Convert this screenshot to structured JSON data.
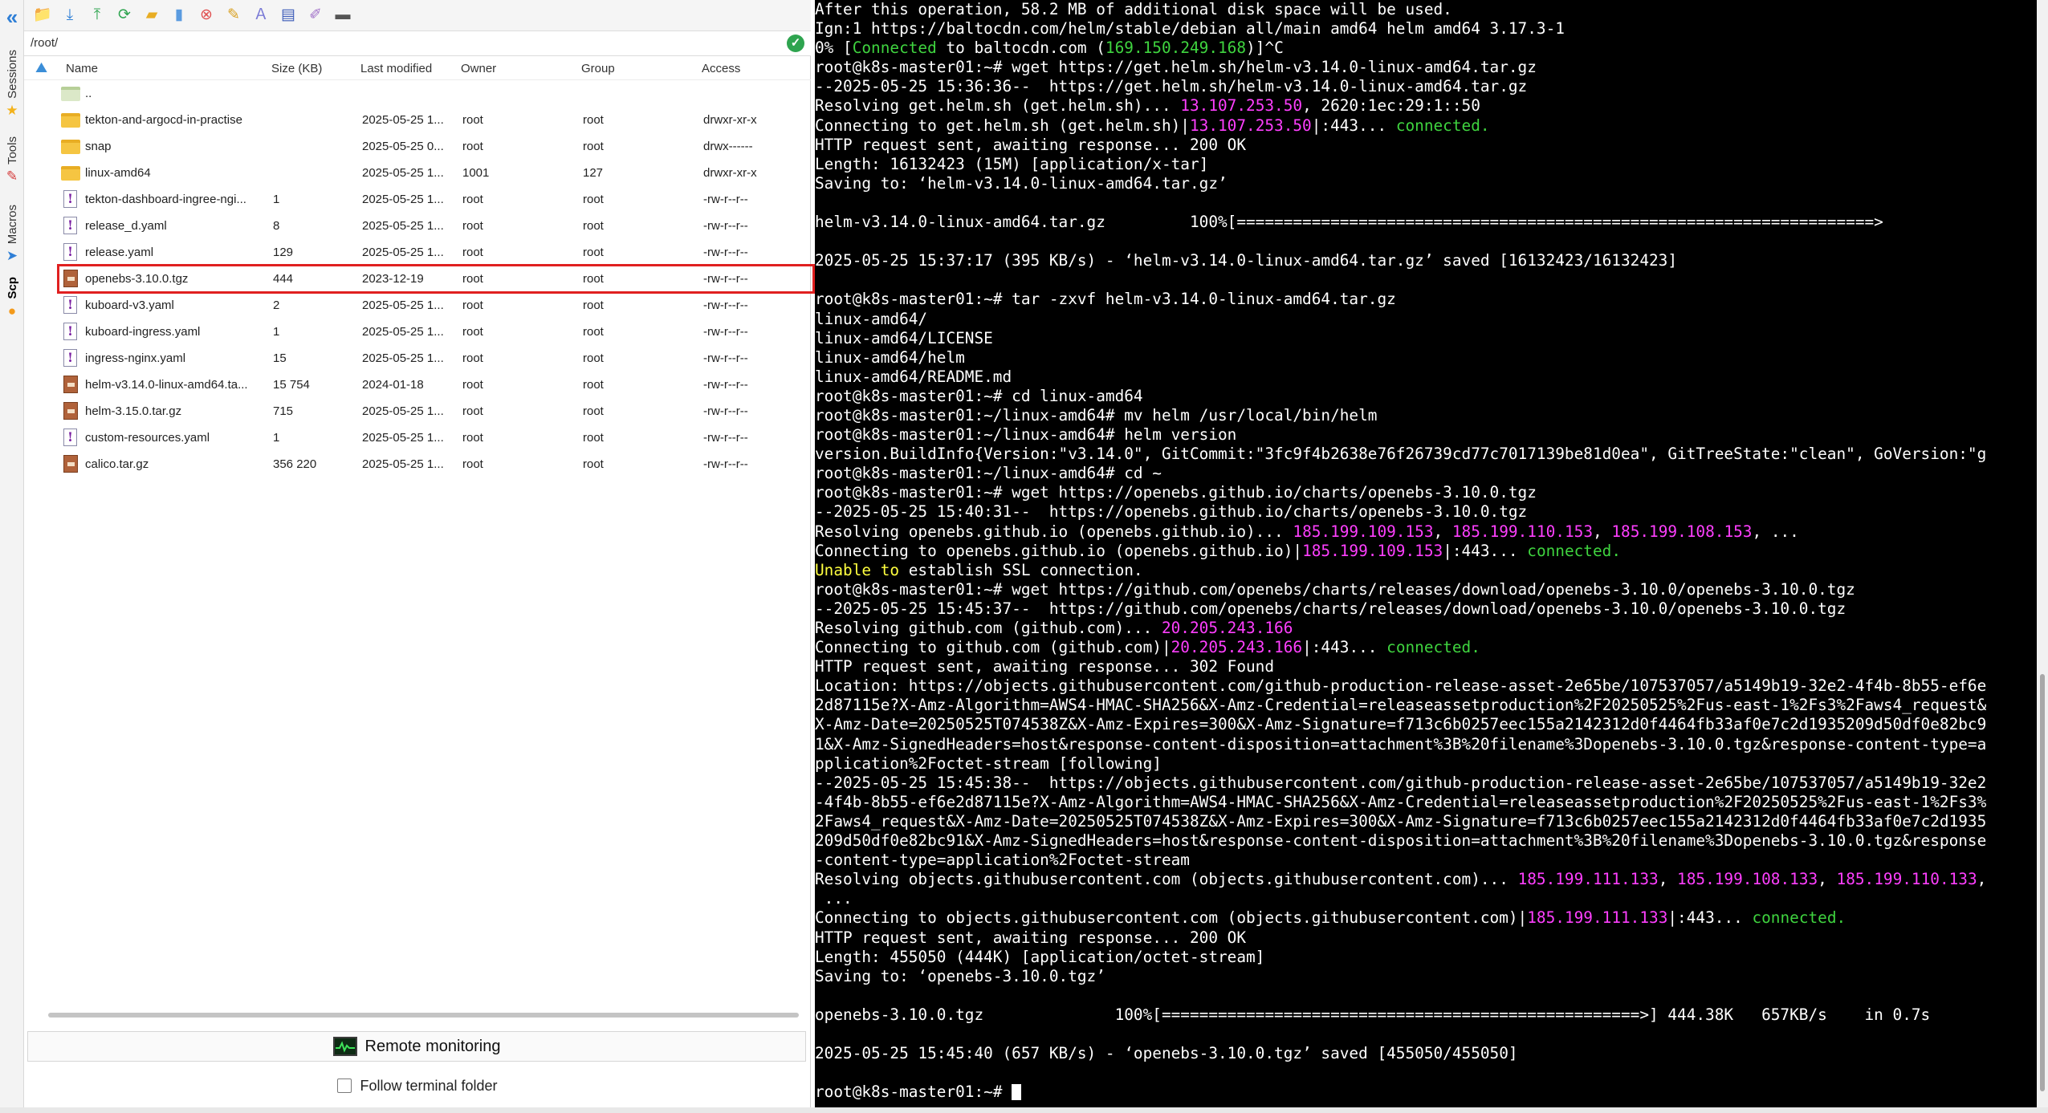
{
  "sidebar": {
    "tabs": [
      {
        "label": "Sessions",
        "icon": "star-icon"
      },
      {
        "label": "Tools",
        "icon": "tools-icon"
      },
      {
        "label": "Macros",
        "icon": "macros-icon"
      },
      {
        "label": "Scp",
        "icon": "scp-icon"
      }
    ]
  },
  "toolbar": {
    "buttons": [
      "upload-folder-icon",
      "download-icon",
      "upload-icon",
      "refresh-icon",
      "new-folder-icon",
      "new-file-icon",
      "delete-icon",
      "wrench-icon",
      "rename-icon",
      "properties-icon",
      "edit-icon",
      "terminal-icon"
    ]
  },
  "path": {
    "value": "/root/"
  },
  "file_table": {
    "columns": [
      "Name",
      "Size (KB)",
      "Last modified",
      "Owner",
      "Group",
      "Access"
    ],
    "rows": [
      {
        "type": "up",
        "name": "..",
        "size": "",
        "modified": "",
        "owner": "",
        "group": "",
        "access": ""
      },
      {
        "type": "folder",
        "name": "tekton-and-argocd-in-practise",
        "size": "",
        "modified": "2025-05-25 1...",
        "owner": "root",
        "group": "root",
        "access": "drwxr-xr-x"
      },
      {
        "type": "folder",
        "name": "snap",
        "size": "",
        "modified": "2025-05-25 0...",
        "owner": "root",
        "group": "root",
        "access": "drwx------"
      },
      {
        "type": "folder",
        "name": "linux-amd64",
        "size": "",
        "modified": "2025-05-25 1...",
        "owner": "1001",
        "group": "127",
        "access": "drwxr-xr-x"
      },
      {
        "type": "yaml",
        "name": "tekton-dashboard-ingree-ngi...",
        "size": "1",
        "modified": "2025-05-25 1...",
        "owner": "root",
        "group": "root",
        "access": "-rw-r--r--"
      },
      {
        "type": "yaml",
        "name": "release_d.yaml",
        "size": "8",
        "modified": "2025-05-25 1...",
        "owner": "root",
        "group": "root",
        "access": "-rw-r--r--"
      },
      {
        "type": "yaml",
        "name": "release.yaml",
        "size": "129",
        "modified": "2025-05-25 1...",
        "owner": "root",
        "group": "root",
        "access": "-rw-r--r--"
      },
      {
        "type": "tgz",
        "name": "openebs-3.10.0.tgz",
        "size": "444",
        "modified": "2023-12-19",
        "owner": "root",
        "group": "root",
        "access": "-rw-r--r--"
      },
      {
        "type": "yaml",
        "name": "kuboard-v3.yaml",
        "size": "2",
        "modified": "2025-05-25 1...",
        "owner": "root",
        "group": "root",
        "access": "-rw-r--r--"
      },
      {
        "type": "yaml",
        "name": "kuboard-ingress.yaml",
        "size": "1",
        "modified": "2025-05-25 1...",
        "owner": "root",
        "group": "root",
        "access": "-rw-r--r--"
      },
      {
        "type": "yaml",
        "name": "ingress-nginx.yaml",
        "size": "15",
        "modified": "2025-05-25 1...",
        "owner": "root",
        "group": "root",
        "access": "-rw-r--r--"
      },
      {
        "type": "tgz",
        "name": "helm-v3.14.0-linux-amd64.ta...",
        "size": "15 754",
        "modified": "2024-01-18",
        "owner": "root",
        "group": "root",
        "access": "-rw-r--r--"
      },
      {
        "type": "tgz",
        "name": "helm-3.15.0.tar.gz",
        "size": "715",
        "modified": "2025-05-25 1...",
        "owner": "root",
        "group": "root",
        "access": "-rw-r--r--"
      },
      {
        "type": "yaml",
        "name": "custom-resources.yaml",
        "size": "1",
        "modified": "2025-05-25 1...",
        "owner": "root",
        "group": "root",
        "access": "-rw-r--r--"
      },
      {
        "type": "tgz",
        "name": "calico.tar.gz",
        "size": "356 220",
        "modified": "2025-05-25 1...",
        "owner": "root",
        "group": "root",
        "access": "-rw-r--r--"
      }
    ]
  },
  "highlighted_row": 7,
  "remote_monitoring": {
    "label": "Remote monitoring"
  },
  "follow_terminal": {
    "label": "Follow terminal folder",
    "checked": false
  },
  "colors": {
    "green": "#3fd43f",
    "magenta": "#ff3fff",
    "yellow": "#ffff3f",
    "highlight": "#e02020"
  },
  "terminal": {
    "lines": [
      [
        {
          "t": "After this operation, 58.2 MB of additional disk space will be used."
        }
      ],
      [
        {
          "t": "Ign:1 https://baltocdn.com/helm/stable/debian all/main amd64 helm amd64 3.17.3-1"
        }
      ],
      [
        {
          "t": "0% ["
        },
        {
          "t": "Connected",
          "c": "g"
        },
        {
          "t": " to baltocdn.com ("
        },
        {
          "t": "169.150.249.168",
          "c": "g"
        },
        {
          "t": ")]^C"
        }
      ],
      [
        {
          "t": "root@k8s-master01:~# wget https://get.helm.sh/helm-v3.14.0-linux-amd64.tar.gz"
        }
      ],
      [
        {
          "t": "--2025-05-25 15:36:36--  https://get.helm.sh/helm-v3.14.0-linux-amd64.tar.gz"
        }
      ],
      [
        {
          "t": "Resolving get.helm.sh (get.helm.sh)... "
        },
        {
          "t": "13.107.253.50",
          "c": "m"
        },
        {
          "t": ", 2620:1ec:29:1::50"
        }
      ],
      [
        {
          "t": "Connecting to get.helm.sh (get.helm.sh)|"
        },
        {
          "t": "13.107.253.50",
          "c": "m"
        },
        {
          "t": "|:443... "
        },
        {
          "t": "connected.",
          "c": "g"
        }
      ],
      [
        {
          "t": "HTTP request sent, awaiting response... 200 OK"
        }
      ],
      [
        {
          "t": "Length: 16132423 (15M) [application/x-tar]"
        }
      ],
      [
        {
          "t": "Saving to: ‘helm-v3.14.0-linux-amd64.tar.gz’"
        }
      ],
      [
        {
          "t": ""
        }
      ],
      [
        {
          "t": "helm-v3.14.0-linux-amd64.tar.gz         100%[====================================================================>"
        }
      ],
      [
        {
          "t": ""
        }
      ],
      [
        {
          "t": "2025-05-25 15:37:17 (395 KB/s) - ‘helm-v3.14.0-linux-amd64.tar.gz’ saved [16132423/16132423]"
        }
      ],
      [
        {
          "t": ""
        }
      ],
      [
        {
          "t": "root@k8s-master01:~# tar -zxvf helm-v3.14.0-linux-amd64.tar.gz"
        }
      ],
      [
        {
          "t": "linux-amd64/"
        }
      ],
      [
        {
          "t": "linux-amd64/LICENSE"
        }
      ],
      [
        {
          "t": "linux-amd64/helm"
        }
      ],
      [
        {
          "t": "linux-amd64/README.md"
        }
      ],
      [
        {
          "t": "root@k8s-master01:~# cd linux-amd64"
        }
      ],
      [
        {
          "t": "root@k8s-master01:~/linux-amd64# mv helm /usr/local/bin/helm"
        }
      ],
      [
        {
          "t": "root@k8s-master01:~/linux-amd64# helm version"
        }
      ],
      [
        {
          "t": "version.BuildInfo{Version:\"v3.14.0\", GitCommit:\"3fc9f4b2638e76f26739cd77c7017139be81d0ea\", GitTreeState:\"clean\", GoVersion:\"g"
        }
      ],
      [
        {
          "t": "root@k8s-master01:~/linux-amd64# cd ~"
        }
      ],
      [
        {
          "t": "root@k8s-master01:~# wget https://openebs.github.io/charts/openebs-3.10.0.tgz"
        }
      ],
      [
        {
          "t": "--2025-05-25 15:40:31--  https://openebs.github.io/charts/openebs-3.10.0.tgz"
        }
      ],
      [
        {
          "t": "Resolving openebs.github.io (openebs.github.io)... "
        },
        {
          "t": "185.199.109.153",
          "c": "m"
        },
        {
          "t": ", "
        },
        {
          "t": "185.199.110.153",
          "c": "m"
        },
        {
          "t": ", "
        },
        {
          "t": "185.199.108.153",
          "c": "m"
        },
        {
          "t": ", ..."
        }
      ],
      [
        {
          "t": "Connecting to openebs.github.io (openebs.github.io)|"
        },
        {
          "t": "185.199.109.153",
          "c": "m"
        },
        {
          "t": "|:443... "
        },
        {
          "t": "connected.",
          "c": "g"
        }
      ],
      [
        {
          "t": "Unable to",
          "c": "y"
        },
        {
          "t": " establish SSL connection."
        }
      ],
      [
        {
          "t": "root@k8s-master01:~# wget https://github.com/openebs/charts/releases/download/openebs-3.10.0/openebs-3.10.0.tgz"
        }
      ],
      [
        {
          "t": "--2025-05-25 15:45:37--  https://github.com/openebs/charts/releases/download/openebs-3.10.0/openebs-3.10.0.tgz"
        }
      ],
      [
        {
          "t": "Resolving github.com (github.com)... "
        },
        {
          "t": "20.205.243.166",
          "c": "m"
        }
      ],
      [
        {
          "t": "Connecting to github.com (github.com)|"
        },
        {
          "t": "20.205.243.166",
          "c": "m"
        },
        {
          "t": "|:443... "
        },
        {
          "t": "connected.",
          "c": "g"
        }
      ],
      [
        {
          "t": "HTTP request sent, awaiting response... 302 Found"
        }
      ],
      [
        {
          "t": "Location: https://objects.githubusercontent.com/github-production-release-asset-2e65be/107537057/a5149b19-32e2-4f4b-8b55-ef6e"
        }
      ],
      [
        {
          "t": "2d87115e?X-Amz-Algorithm=AWS4-HMAC-SHA256&X-Amz-Credential=releaseassetproduction%2F20250525%2Fus-east-1%2Fs3%2Faws4_request&"
        }
      ],
      [
        {
          "t": "X-Amz-Date=20250525T074538Z&X-Amz-Expires=300&X-Amz-Signature=f713c6b0257eec155a2142312d0f4464fb33af0e7c2d1935209d50df0e82bc9"
        }
      ],
      [
        {
          "t": "1&X-Amz-SignedHeaders=host&response-content-disposition=attachment%3B%20filename%3Dopenebs-3.10.0.tgz&response-content-type=a"
        }
      ],
      [
        {
          "t": "pplication%2Foctet-stream [following]"
        }
      ],
      [
        {
          "t": "--2025-05-25 15:45:38--  https://objects.githubusercontent.com/github-production-release-asset-2e65be/107537057/a5149b19-32e2"
        }
      ],
      [
        {
          "t": "-4f4b-8b55-ef6e2d87115e?X-Amz-Algorithm=AWS4-HMAC-SHA256&X-Amz-Credential=releaseassetproduction%2F20250525%2Fus-east-1%2Fs3%"
        }
      ],
      [
        {
          "t": "2Faws4_request&X-Amz-Date=20250525T074538Z&X-Amz-Expires=300&X-Amz-Signature=f713c6b0257eec155a2142312d0f4464fb33af0e7c2d1935"
        }
      ],
      [
        {
          "t": "209d50df0e82bc91&X-Amz-SignedHeaders=host&response-content-disposition=attachment%3B%20filename%3Dopenebs-3.10.0.tgz&response"
        }
      ],
      [
        {
          "t": "-content-type=application%2Foctet-stream"
        }
      ],
      [
        {
          "t": "Resolving objects.githubusercontent.com (objects.githubusercontent.com)... "
        },
        {
          "t": "185.199.111.133",
          "c": "m"
        },
        {
          "t": ", "
        },
        {
          "t": "185.199.108.133",
          "c": "m"
        },
        {
          "t": ", "
        },
        {
          "t": "185.199.110.133",
          "c": "m"
        },
        {
          "t": ","
        }
      ],
      [
        {
          "t": " ..."
        }
      ],
      [
        {
          "t": "Connecting to objects.githubusercontent.com (objects.githubusercontent.com)|"
        },
        {
          "t": "185.199.111.133",
          "c": "m"
        },
        {
          "t": "|:443... "
        },
        {
          "t": "connected.",
          "c": "g"
        }
      ],
      [
        {
          "t": "HTTP request sent, awaiting response... 200 OK"
        }
      ],
      [
        {
          "t": "Length: 455050 (444K) [application/octet-stream]"
        }
      ],
      [
        {
          "t": "Saving to: ‘openebs-3.10.0.tgz’"
        }
      ],
      [
        {
          "t": ""
        }
      ],
      [
        {
          "t": "openebs-3.10.0.tgz              100%[===================================================>] 444.38K   657KB/s    in 0.7s"
        }
      ],
      [
        {
          "t": ""
        }
      ],
      [
        {
          "t": "2025-05-25 15:45:40 (657 KB/s) - ‘openebs-3.10.0.tgz’ saved [455050/455050]"
        }
      ],
      [
        {
          "t": ""
        }
      ],
      [
        {
          "t": "root@k8s-master01:~# "
        }
      ]
    ]
  }
}
